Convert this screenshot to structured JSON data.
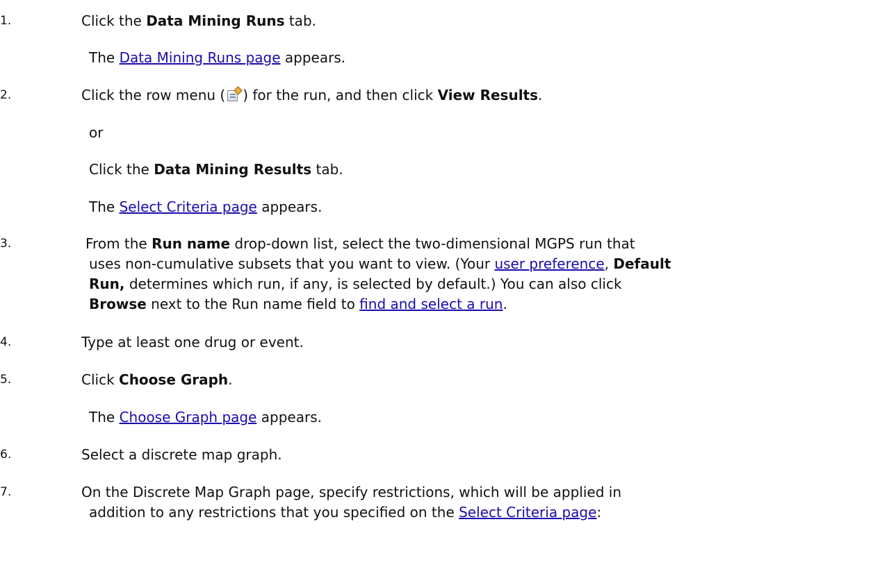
{
  "steps": [
    {
      "num": "1.",
      "text_before": "Click the ",
      "bold": "Data Mining Runs",
      "text_after": " tab."
    },
    {
      "num": "2.",
      "text_before": "Click the row menu (",
      "text_middle": ") for the run, and then click ",
      "bold": "View Results",
      "text_after": "."
    },
    {
      "num": "3.",
      "pre": " From the ",
      "bold1": "Run name",
      "mid1": " drop-down list, select the two-dimensional MGPS run that",
      "line2_a": "uses non-cumulative subsets that you want to view. (Your ",
      "link_user_pref": "user preference",
      "line2_b": ", ",
      "bold2": "Default Run,",
      "line3_a": " determines which run, if any, is selected by default.) You can also click ",
      "bold3": "Browse",
      "line4_a": " next to the Run name field to ",
      "link_find_run": "find and select a run",
      "line4_b": "."
    },
    {
      "num": "4.",
      "text": "Type at least one drug or event."
    },
    {
      "num": "5.",
      "text_before": "Click ",
      "bold": "Choose Graph",
      "text_after": "."
    },
    {
      "num": "6.",
      "text": "Select a discrete map graph."
    },
    {
      "num": "7.",
      "line1": "On the Discrete Map Graph page, specify restrictions, which will be applied in",
      "line2_a": "addition to any restrictions that you specified on the ",
      "link": "Select Criteria page",
      "line2_b": ":"
    }
  ],
  "notes": {
    "runs_page": {
      "pre": "The ",
      "link": "Data Mining Runs page",
      "post": " appears."
    },
    "or": "or",
    "results_tab": {
      "pre": "Click the ",
      "bold": "Data Mining Results",
      "post": " tab."
    },
    "criteria_page": {
      "pre": "The ",
      "link": "Select Criteria page",
      "post": " appears."
    },
    "graph_page": {
      "pre": "The ",
      "link": "Choose Graph page",
      "post": " appears."
    }
  },
  "icons": {
    "row_menu": "row-menu-icon"
  }
}
